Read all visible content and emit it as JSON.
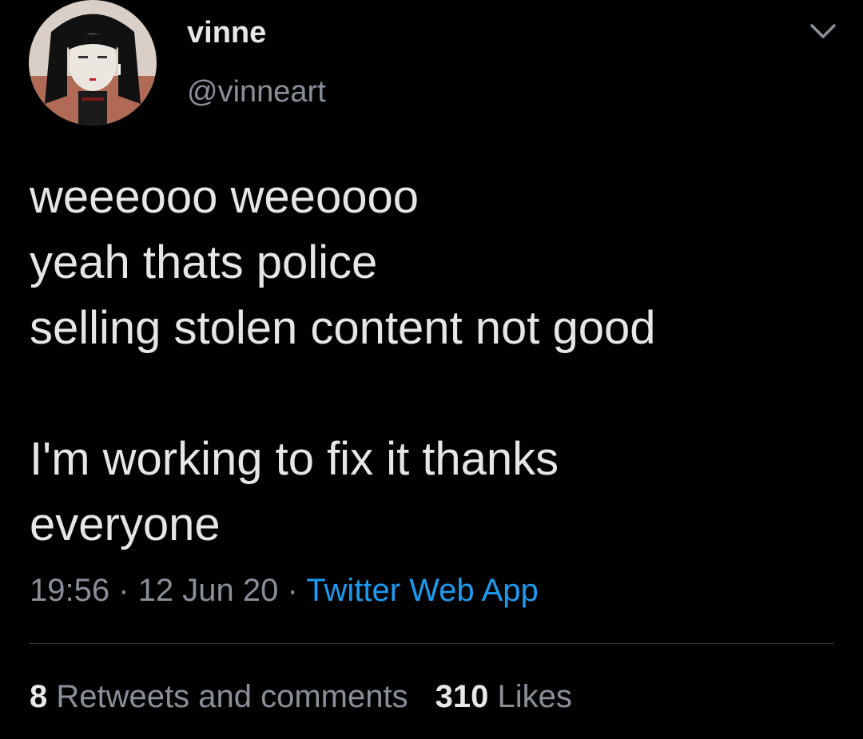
{
  "author": {
    "display_name": "vinne",
    "handle": "@vinneart"
  },
  "tweet": {
    "lines": [
      "weeeooo weeoooo",
      "yeah thats police",
      "selling stolen content not good",
      "",
      "I'm working to fix it thanks",
      "everyone"
    ],
    "time": "19:56",
    "separator": "·",
    "date": "12 Jun 20",
    "source": "Twitter Web App"
  },
  "stats": {
    "retweets_count": "8",
    "retweets_label": "Retweets and comments",
    "likes_count": "310",
    "likes_label": "Likes"
  },
  "icons": {
    "menu": "chevron-down-icon",
    "avatar": "avatar-image"
  },
  "colors": {
    "background": "#000000",
    "text": "#e6e6e6",
    "secondary_text": "#8a9099",
    "link": "#1d9bf0",
    "divider": "#2f3336"
  }
}
